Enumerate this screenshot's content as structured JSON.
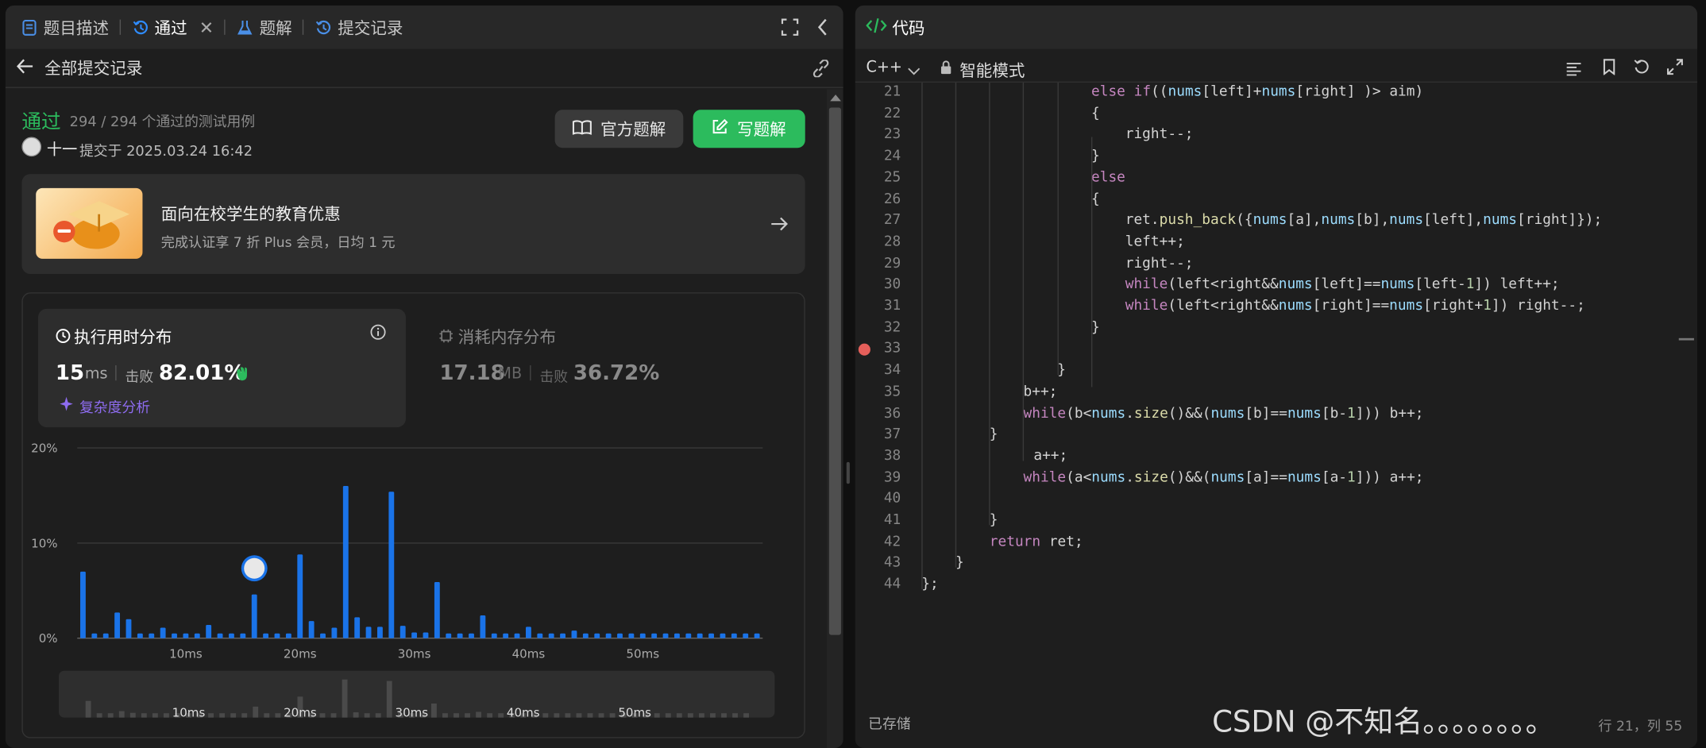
{
  "left_tabs": [
    {
      "label": "题目描述",
      "icon": "document-icon"
    },
    {
      "label": "通过",
      "icon": "history-icon"
    },
    {
      "label": "题解",
      "icon": "flask-icon"
    },
    {
      "label": "提交记录",
      "icon": "history-icon"
    }
  ],
  "subbar": {
    "back_label": "全部提交记录"
  },
  "submission": {
    "status": "通过",
    "tests": "294 / 294 个通过的测试用例",
    "user": "十一",
    "submitted": "提交于 2025.03.24 16:42",
    "official_solution": "官方题解",
    "write_solution": "写题解"
  },
  "promo": {
    "title": "面向在校学生的教育优惠",
    "subtitle": "完成认证享 7 折 Plus 会员，日均 1 元"
  },
  "stats": {
    "runtime_title": "执行用时分布",
    "runtime_value": "15",
    "runtime_unit": "ms",
    "beats_label": "击败",
    "runtime_beats": "82.01%",
    "complexity": "复杂度分析",
    "memory_title": "消耗内存分布",
    "memory_value": "17.18",
    "memory_unit": "MB",
    "memory_beats_label": "击败",
    "memory_beats": "36.72%"
  },
  "chart_data": {
    "type": "bar",
    "title": "执行用时分布",
    "ylim": [
      0,
      20
    ],
    "y_ticks": [
      "20%",
      "10%",
      "0%"
    ],
    "x_tick_labels": [
      "10ms",
      "20ms",
      "30ms",
      "40ms",
      "50ms"
    ],
    "x_tick_values": [
      10,
      20,
      30,
      40,
      50
    ],
    "x": [
      1,
      2,
      3,
      4,
      5,
      6,
      7,
      8,
      9,
      10,
      11,
      12,
      13,
      14,
      15,
      16,
      17,
      18,
      19,
      20,
      21,
      22,
      23,
      24,
      25,
      26,
      27,
      28,
      29,
      30,
      31,
      32,
      33,
      34,
      35,
      36,
      37,
      38,
      39,
      40,
      41,
      42,
      43,
      44,
      45,
      46,
      47,
      48,
      49,
      50,
      51,
      52,
      53,
      54,
      55,
      56,
      57,
      58,
      59,
      60
    ],
    "values": [
      7.0,
      0.5,
      0.5,
      2.7,
      2.0,
      0.5,
      0.5,
      1.1,
      0.5,
      0.5,
      0.5,
      1.4,
      0.5,
      0.5,
      0.5,
      4.6,
      0.5,
      0.5,
      0.5,
      8.8,
      1.8,
      0.5,
      1.1,
      16.0,
      2.2,
      1.2,
      1.2,
      15.4,
      1.3,
      0.6,
      0.6,
      5.9,
      0.5,
      0.5,
      0.5,
      2.4,
      0.5,
      0.5,
      0.5,
      1.2,
      0.5,
      0.5,
      0.5,
      0.8,
      0.5,
      0.5,
      0.5,
      0.5,
      0.5,
      0.5,
      0.5,
      0.5,
      0.5,
      0.5,
      0.5,
      0.5,
      0.5,
      0.5,
      0.5,
      0.5
    ],
    "highlight_x": 16,
    "bar_color": "#1a73e8",
    "grid": true
  },
  "right": {
    "title": "代码",
    "language": "C++",
    "mode": "智能模式",
    "status": "已存储",
    "cursor": "行 21，列 55",
    "watermark": "CSDN @不知名。。。。。。。。"
  },
  "code_lines": [
    {
      "n": "21",
      "text": "else if((nums[left]+nums[right] )> aim)"
    },
    {
      "n": "22",
      "text": "{"
    },
    {
      "n": "23",
      "text": "right--;"
    },
    {
      "n": "24",
      "text": "}"
    },
    {
      "n": "25",
      "text": "else"
    },
    {
      "n": "26",
      "text": "{"
    },
    {
      "n": "27",
      "text": "ret.push_back({nums[a],nums[b],nums[left],nums[right]});"
    },
    {
      "n": "28",
      "text": "left++;"
    },
    {
      "n": "29",
      "text": "right--;"
    },
    {
      "n": "30",
      "text": "while(left<right&&nums[left]==nums[left-1]) left++;"
    },
    {
      "n": "31",
      "text": "while(left<right&&nums[right]==nums[right+1]) right--;"
    },
    {
      "n": "32",
      "text": "}"
    },
    {
      "n": "33",
      "text": ""
    },
    {
      "n": "34",
      "text": "}"
    },
    {
      "n": "35",
      "text": "b++;"
    },
    {
      "n": "36",
      "text": "while(b<nums.size()&&(nums[b]==nums[b-1])) b++;"
    },
    {
      "n": "37",
      "text": "}"
    },
    {
      "n": "38",
      "text": "a++;"
    },
    {
      "n": "39",
      "text": "while(a<nums.size()&&(nums[a]==nums[a-1])) a++;"
    },
    {
      "n": "40",
      "text": ""
    },
    {
      "n": "41",
      "text": "}"
    },
    {
      "n": "42",
      "text": "return ret;"
    },
    {
      "n": "43",
      "text": "}"
    },
    {
      "n": "44",
      "text": "};"
    }
  ]
}
